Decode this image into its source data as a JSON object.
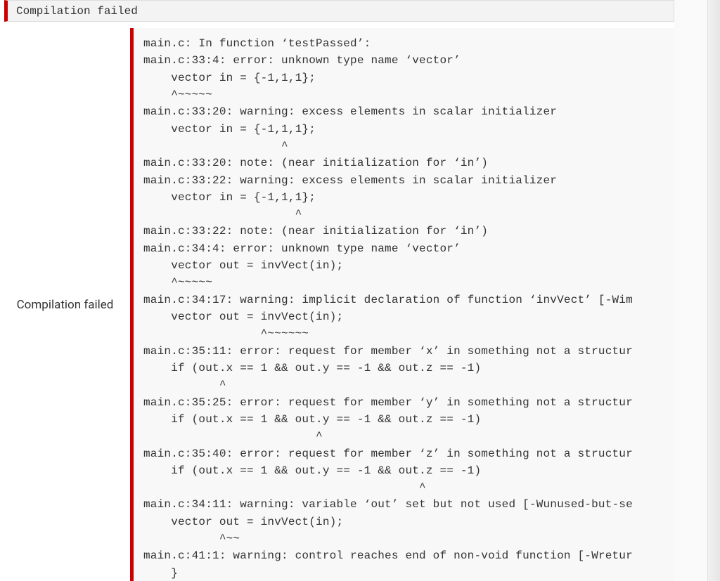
{
  "header": {
    "title": "Compilation failed"
  },
  "sidebar": {
    "label": "Compilation failed"
  },
  "compiler_output": {
    "lines": [
      "main.c: In function ‘testPassed’:",
      "main.c:33:4: error: unknown type name ‘vector’",
      "    vector in = {-1,1,1};",
      "    ^~~~~~",
      "main.c:33:20: warning: excess elements in scalar initializer",
      "    vector in = {-1,1,1};",
      "                    ^",
      "main.c:33:20: note: (near initialization for ‘in’)",
      "main.c:33:22: warning: excess elements in scalar initializer",
      "    vector in = {-1,1,1};",
      "                      ^",
      "main.c:33:22: note: (near initialization for ‘in’)",
      "main.c:34:4: error: unknown type name ‘vector’",
      "    vector out = invVect(in);",
      "    ^~~~~~",
      "main.c:34:17: warning: implicit declaration of function ‘invVect’ [-Wim",
      "    vector out = invVect(in);",
      "                 ^~~~~~~",
      "main.c:35:11: error: request for member ‘x’ in something not a structur",
      "    if (out.x == 1 && out.y == -1 && out.z == -1)",
      "           ^",
      "main.c:35:25: error: request for member ‘y’ in something not a structur",
      "    if (out.x == 1 && out.y == -1 && out.z == -1)",
      "                         ^",
      "main.c:35:40: error: request for member ‘z’ in something not a structur",
      "    if (out.x == 1 && out.y == -1 && out.z == -1)",
      "                                        ^",
      "main.c:34:11: warning: variable ‘out’ set but not used [-Wunused-but-se",
      "    vector out = invVect(in);",
      "           ^~~",
      "main.c:41:1: warning: control reaches end of non-void function [-Wretur",
      "    }"
    ]
  }
}
